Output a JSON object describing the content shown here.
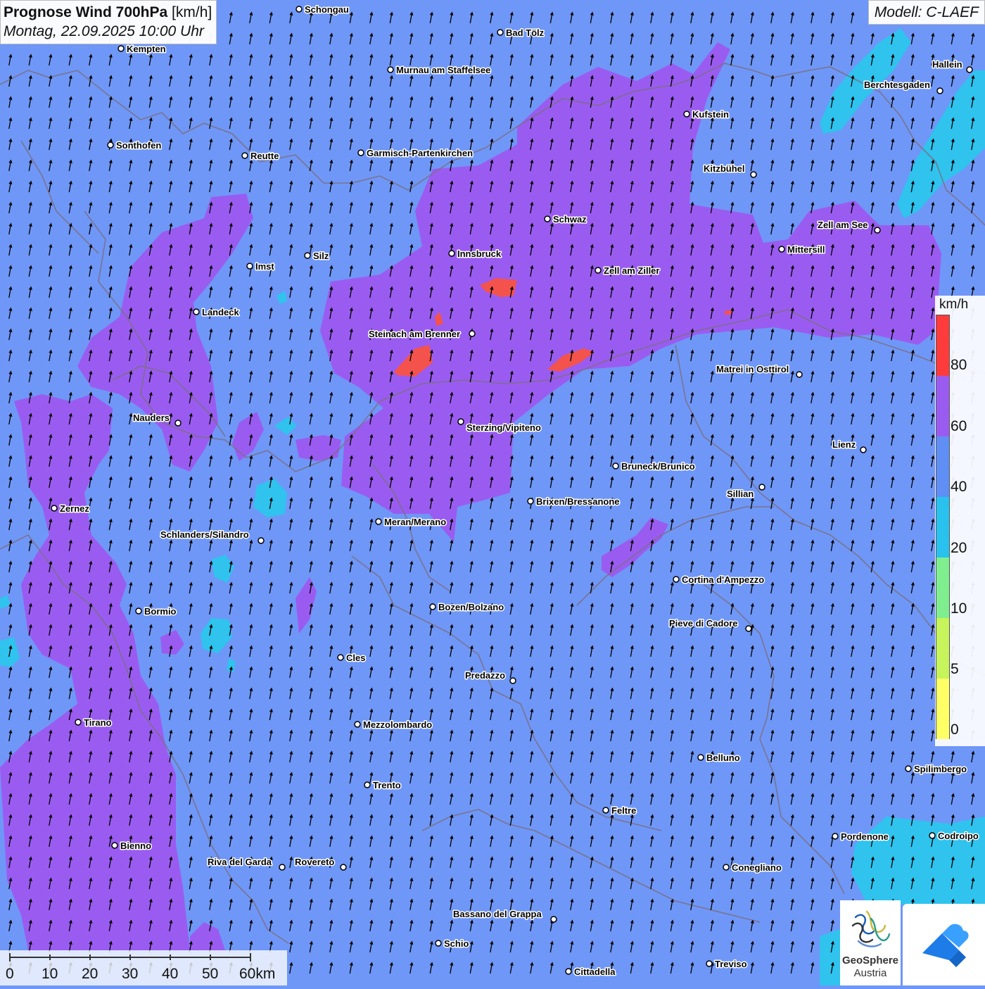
{
  "title": {
    "main": "Prognose Wind 700hPa",
    "unit": "[km/h]",
    "date": "Montag, 22.09.2025 10:00 Uhr"
  },
  "model": "Modell: C-LAEF",
  "legend": {
    "unit": "km/h",
    "labels": [
      "80",
      "60",
      "40",
      "20",
      "10",
      "5",
      "0"
    ],
    "colors": [
      "#ff3b3b",
      "#9a5cf0",
      "#5f8ef5",
      "#29c2ee",
      "#7fee8e",
      "#c6f45a",
      "#ffff66"
    ]
  },
  "scale": {
    "labels": [
      "0",
      "10",
      "20",
      "30",
      "40",
      "50",
      "60km"
    ]
  },
  "logos": {
    "geosphere_name": "GeoSphere",
    "geosphere_sub": "Austria"
  },
  "map": {
    "wind_direction": "south-southwest (arrows pointing north)",
    "colors": {
      "background": "#6f97f7",
      "band_60_80": "#9a5cf0",
      "band_20_40": "#2fc3ee",
      "band_80_plus": "#f4524c",
      "border": "#7a6e80"
    }
  },
  "cities": [
    {
      "name": "Schongau"
    },
    {
      "name": "Bad Tölz"
    },
    {
      "name": "Kempten"
    },
    {
      "name": "Murnau am Staffelsee"
    },
    {
      "name": "Hallein"
    },
    {
      "name": "Berchtesgaden"
    },
    {
      "name": "Kufstein"
    },
    {
      "name": "Sonthofen"
    },
    {
      "name": "Reutte"
    },
    {
      "name": "Garmisch-Partenkirchen"
    },
    {
      "name": "Kitzbühel"
    },
    {
      "name": "Schwaz"
    },
    {
      "name": "Zell am See"
    },
    {
      "name": "Mittersill"
    },
    {
      "name": "Innsbruck"
    },
    {
      "name": "Imst"
    },
    {
      "name": "Silz"
    },
    {
      "name": "Zell am Ziller"
    },
    {
      "name": "Landeck"
    },
    {
      "name": "Steinach am Brenner"
    },
    {
      "name": "Matrei in Osttirol"
    },
    {
      "name": "Nauders"
    },
    {
      "name": "Sterzing/Vipiteno"
    },
    {
      "name": "Lienz"
    },
    {
      "name": "Bruneck/Brunico"
    },
    {
      "name": "Sillian"
    },
    {
      "name": "Zernez"
    },
    {
      "name": "Brixen/Bressanone"
    },
    {
      "name": "Meran/Merano"
    },
    {
      "name": "Schlanders/Silandro"
    },
    {
      "name": "Cortina d'Ampezzo"
    },
    {
      "name": "Bozen/Bolzano"
    },
    {
      "name": "Bormio"
    },
    {
      "name": "Pieve di Cadore"
    },
    {
      "name": "Cles"
    },
    {
      "name": "Predazzo"
    },
    {
      "name": "Tirano"
    },
    {
      "name": "Mezzolombardo"
    },
    {
      "name": "Belluno"
    },
    {
      "name": "Spilimbergo"
    },
    {
      "name": "Trento"
    },
    {
      "name": "Feltre"
    },
    {
      "name": "Pordenone"
    },
    {
      "name": "Codroipo"
    },
    {
      "name": "Bienno"
    },
    {
      "name": "Riva del Garda"
    },
    {
      "name": "Rovereto"
    },
    {
      "name": "Conegliano"
    },
    {
      "name": "Bassano del Grappa"
    },
    {
      "name": "Schio"
    },
    {
      "name": "Treviso"
    },
    {
      "name": "Cittadella"
    }
  ]
}
